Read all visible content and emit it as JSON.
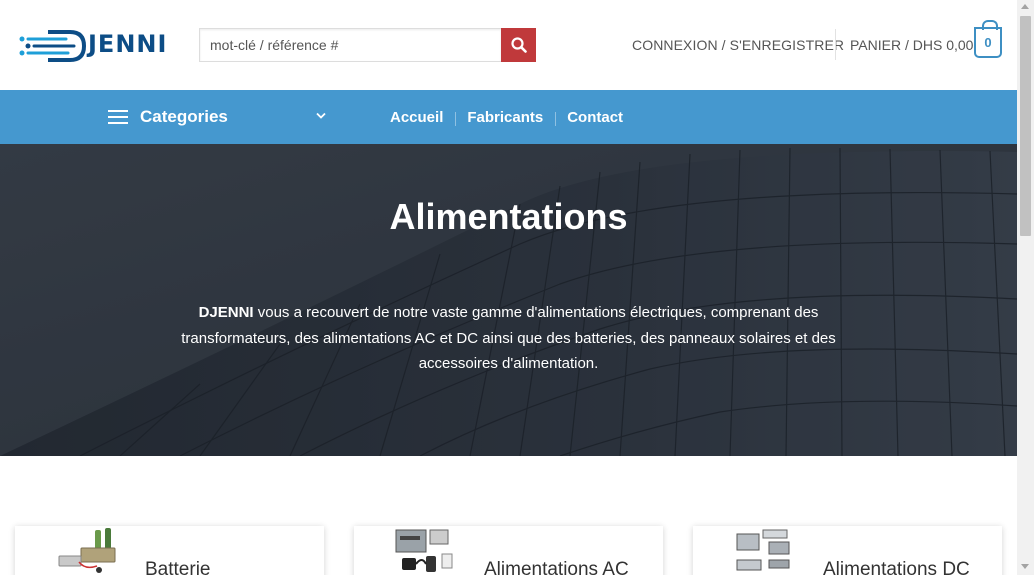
{
  "header": {
    "logo_text": "JENNI",
    "search_placeholder": "mot-clé / référence #",
    "login_label": "CONNEXION / S'ENREGISTRER",
    "cart_label": "PANIER / DHS 0,00",
    "cart_count": "0"
  },
  "nav": {
    "categories_label": "Categories",
    "links": [
      {
        "label": "Accueil"
      },
      {
        "label": "Fabricants"
      },
      {
        "label": "Contact"
      }
    ]
  },
  "hero": {
    "title": "Alimentations",
    "desc_brand": "DJENNI",
    "desc_rest": " vous a recouvert de notre vaste gamme d'alimentations électriques, comprenant des transformateurs, des alimentations AC et DC ainsi que des batteries, des panneaux solaires et des accessoires d'alimentation."
  },
  "cards": [
    {
      "title": "Batterie"
    },
    {
      "title": "Alimentations AC"
    },
    {
      "title": "Alimentations DC"
    }
  ],
  "colors": {
    "nav": "#4598cf",
    "search_button": "#c0393b",
    "logo": "#0d4d86",
    "cart_accent": "#3d8fc3"
  },
  "icons": {
    "search": "search-icon",
    "menu": "hamburger-icon",
    "chevron": "chevron-down-icon",
    "cart": "cart-bag-icon"
  }
}
